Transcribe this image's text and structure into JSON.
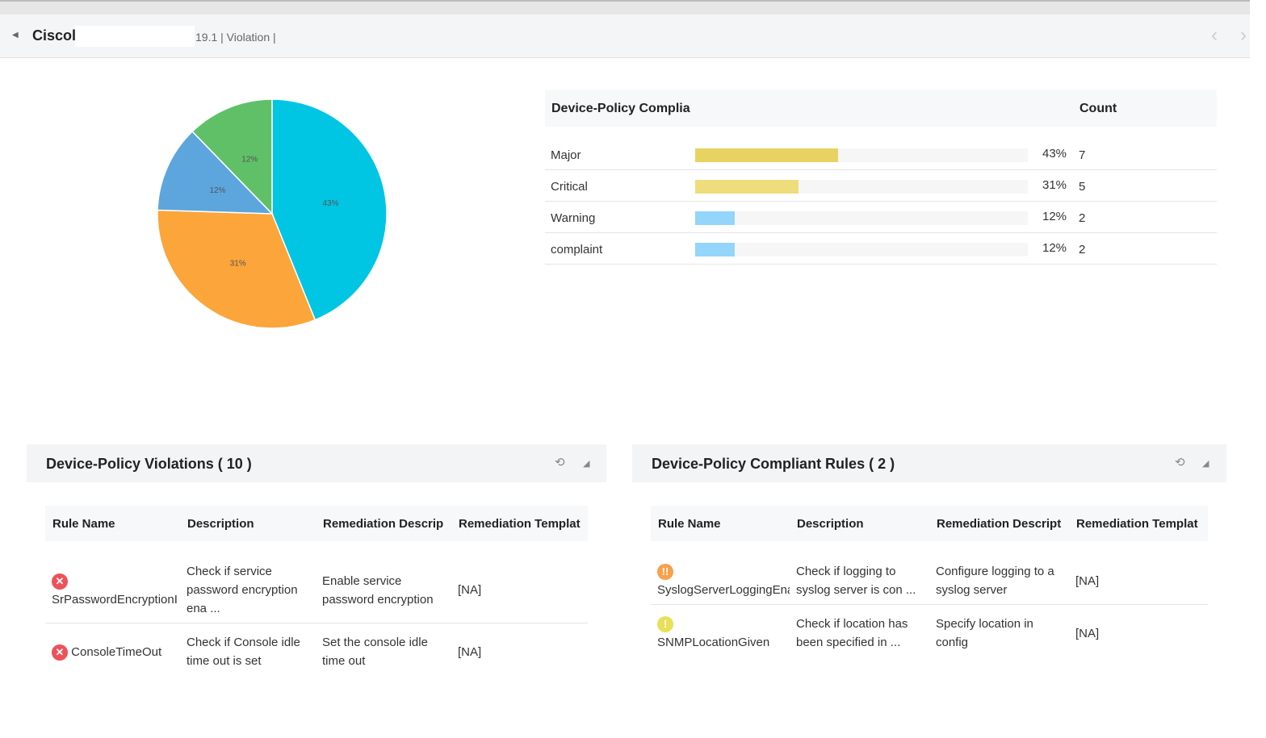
{
  "header": {
    "title": "Ciscol",
    "subtitle": "19.1 | Violation |",
    "back_icon": "caret-left-icon",
    "prev_icon": "chevron-left-icon",
    "next_icon": "chevron-right-icon"
  },
  "chart_data": {
    "type": "pie",
    "slices": [
      {
        "label": "43%",
        "value": 43,
        "color": "#00c5e3"
      },
      {
        "label": "31%",
        "value": 31,
        "color": "#fba53a"
      },
      {
        "label": "12%",
        "value": 12,
        "color": "#5ca6dd"
      },
      {
        "label": "12%",
        "value": 12,
        "color": "#60c068"
      }
    ]
  },
  "legend": {
    "title": "Device-Policy Complia",
    "count_header": "Count",
    "rows": [
      {
        "label": "Major",
        "pct": "43%",
        "value": 43,
        "count": "7",
        "color": "#e8d262"
      },
      {
        "label": "Critical",
        "pct": "31%",
        "value": 31,
        "count": "5",
        "color": "#efdc7c"
      },
      {
        "label": "Warning",
        "pct": "12%",
        "value": 12,
        "count": "2",
        "color": "#93d5fb"
      },
      {
        "label": "complaint",
        "pct": "12%",
        "value": 12,
        "count": "2",
        "color": "#93d5fb"
      }
    ]
  },
  "violations": {
    "title": "Device-Policy Violations ( 10 )",
    "headers": [
      "Rule Name",
      "Description",
      "Remediation Descrip",
      "Remediation Templat"
    ],
    "rows": [
      {
        "icon": "error-icon",
        "name": "SrPasswordEncryptionI",
        "desc": "Check if service password encryption ena ...",
        "rem": "Enable service password encryption",
        "tpl": "[NA]"
      },
      {
        "icon": "error-icon",
        "name": "ConsoleTimeOut",
        "desc": "Check if Console idle time out is set",
        "rem": "Set the console idle time out",
        "tpl": "[NA]"
      }
    ]
  },
  "compliant": {
    "title": "Device-Policy Compliant Rules ( 2 )",
    "headers": [
      "Rule Name",
      "Description",
      "Remediation Descript",
      "Remediation Templat"
    ],
    "rows": [
      {
        "icon": "major-warning-icon",
        "name": "SyslogServerLoggingEna",
        "desc": "Check if logging to syslog server is con ...",
        "rem": "Configure logging to a syslog server",
        "tpl": "[NA]"
      },
      {
        "icon": "warning-icon",
        "name": "SNMPLocationGiven",
        "desc": "Check if location has been specified in ...",
        "rem": "Specify location in config",
        "tpl": "[NA]"
      }
    ]
  },
  "panel_icons": [
    "refresh-icon",
    "minimize-icon"
  ]
}
